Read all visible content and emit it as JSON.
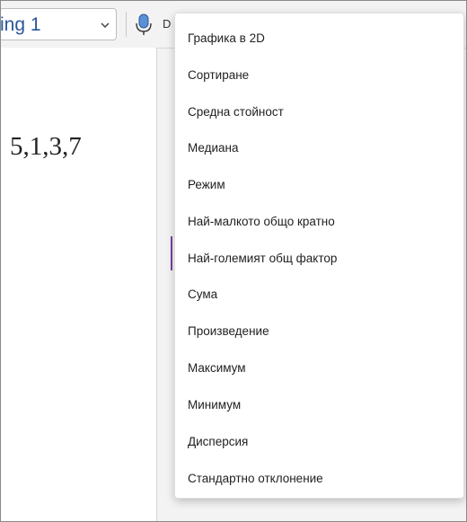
{
  "ribbon": {
    "style_value": "ing 1",
    "dictate_label": "D",
    "accent_color": "#2b579a",
    "icons": [
      "chevron-down-icon",
      "microphone-icon"
    ]
  },
  "document": {
    "text": "5,1,3,7"
  },
  "menu": {
    "items": [
      {
        "label": "Графика в 2D"
      },
      {
        "label": "Сортиране"
      },
      {
        "label": "Средна стойност"
      },
      {
        "label": "Медиана"
      },
      {
        "label": "Режим"
      },
      {
        "label": "Най-малкото общо кратно"
      },
      {
        "label": "Най-големият общ фактор"
      },
      {
        "label": "Сума"
      },
      {
        "label": "Произведение"
      },
      {
        "label": "Максимум"
      },
      {
        "label": "Минимум"
      },
      {
        "label": "Дисперсия"
      },
      {
        "label": "Стандартно отклонение"
      }
    ]
  }
}
